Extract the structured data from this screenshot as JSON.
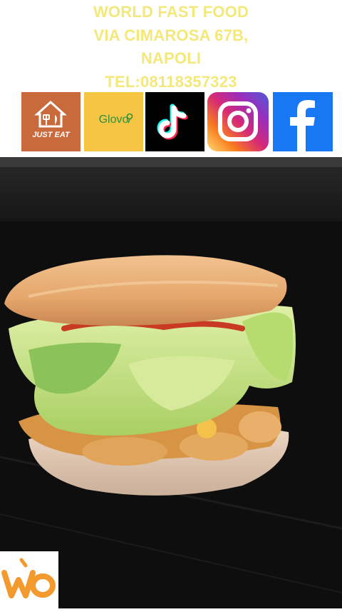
{
  "header": {
    "lines": [
      "WORLD FAST FOOD",
      "VIA CIMAROSA 67B,",
      "NAPOLI",
      "TEL:08118357323"
    ],
    "text_color": "#f3e879"
  },
  "social_tiles": [
    {
      "name": "just-eat",
      "label": "JUST EAT",
      "color": "#c96a3d"
    },
    {
      "name": "glovo",
      "label": "Glovo",
      "color": "#f6c544"
    },
    {
      "name": "tiktok",
      "icon": "tiktok-icon",
      "color": "#000000"
    },
    {
      "name": "instagram",
      "icon": "instagram-icon",
      "color": "#d62976"
    },
    {
      "name": "facebook",
      "icon": "facebook-icon",
      "color": "#1877f2"
    }
  ],
  "photo": {
    "subject": "burger",
    "background_color": "#0d0d0d"
  },
  "corner_logo": {
    "icon": "wo-logo-icon",
    "color": "#f29a2e"
  }
}
